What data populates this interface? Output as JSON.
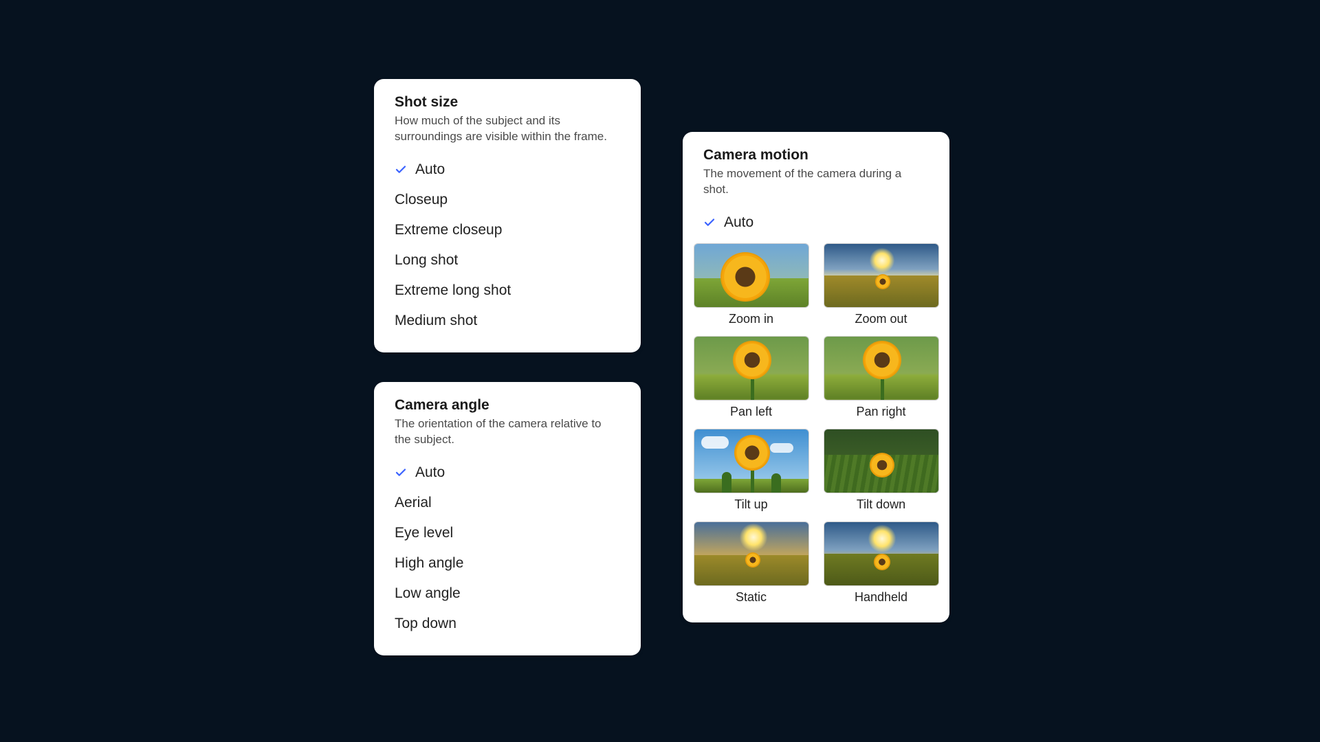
{
  "shot_size": {
    "title": "Shot size",
    "desc": "How much of the subject and its surroundings are visible within the frame.",
    "items": [
      {
        "label": "Auto",
        "selected": true
      },
      {
        "label": "Closeup",
        "selected": false
      },
      {
        "label": "Extreme closeup",
        "selected": false
      },
      {
        "label": "Long shot",
        "selected": false
      },
      {
        "label": "Extreme long shot",
        "selected": false
      },
      {
        "label": "Medium shot",
        "selected": false
      }
    ]
  },
  "camera_angle": {
    "title": "Camera angle",
    "desc": "The orientation of the camera relative to the subject.",
    "items": [
      {
        "label": "Auto",
        "selected": true
      },
      {
        "label": "Aerial",
        "selected": false
      },
      {
        "label": "Eye level",
        "selected": false
      },
      {
        "label": "High angle",
        "selected": false
      },
      {
        "label": "Low angle",
        "selected": false
      },
      {
        "label": "Top down",
        "selected": false
      }
    ]
  },
  "camera_motion": {
    "title": "Camera motion",
    "desc": "The movement of the camera during a shot.",
    "auto_label": "Auto",
    "auto_selected": true,
    "options": [
      {
        "label": "Zoom in",
        "thumb": "zoom-in"
      },
      {
        "label": "Zoom out",
        "thumb": "zoom-out"
      },
      {
        "label": "Pan left",
        "thumb": "pan-left"
      },
      {
        "label": "Pan right",
        "thumb": "pan-right"
      },
      {
        "label": "Tilt up",
        "thumb": "tilt-up"
      },
      {
        "label": "Tilt down",
        "thumb": "tilt-down"
      },
      {
        "label": "Static",
        "thumb": "static"
      },
      {
        "label": "Handheld",
        "thumb": "handheld"
      }
    ]
  },
  "colors": {
    "accent": "#3b63ff",
    "bg": "#06121f",
    "panel": "#ffffff"
  }
}
